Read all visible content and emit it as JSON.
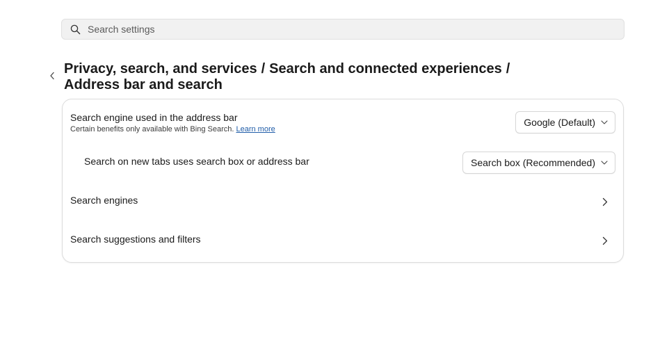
{
  "search": {
    "placeholder": "Search settings"
  },
  "breadcrumb": {
    "items": [
      "Privacy, search, and services",
      "Search and connected experiences",
      "Address bar and search"
    ],
    "separator": "/"
  },
  "settings": {
    "engine": {
      "label": "Search engine used in the address bar",
      "description": "Certain benefits only available with Bing Search.",
      "link": "Learn more",
      "selected": "Google (Default)"
    },
    "new_tabs": {
      "label": "Search on new tabs uses search box or address bar",
      "selected": "Search box (Recommended)"
    },
    "search_engines": {
      "label": "Search engines"
    },
    "suggestions": {
      "label": "Search suggestions and filters"
    }
  },
  "colors": {
    "link": "#1f5ca8",
    "search_bg": "#f1f1f1"
  },
  "icons": {
    "search": "search-icon",
    "back": "chevron-left-icon",
    "dropdown": "chevron-down-icon",
    "nav": "chevron-right-icon"
  }
}
